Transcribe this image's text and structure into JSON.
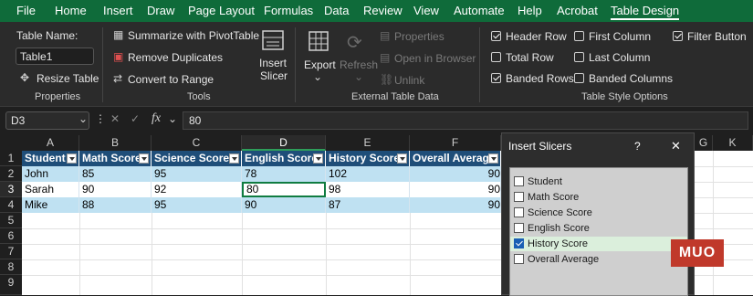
{
  "menu": [
    "File",
    "Home",
    "Insert",
    "Draw",
    "Page Layout",
    "Formulas",
    "Data",
    "Review",
    "View",
    "Automate",
    "Help",
    "Acrobat",
    "Table Design"
  ],
  "ribbon": {
    "properties": {
      "table_name_label": "Table Name:",
      "table_name_value": "Table1",
      "resize": "Resize Table",
      "group": "Properties"
    },
    "tools": {
      "summarize": "Summarize with PivotTable",
      "remove_dup": "Remove Duplicates",
      "convert": "Convert to Range",
      "insert_slicer_1": "Insert",
      "insert_slicer_2": "Slicer",
      "group": "Tools"
    },
    "external": {
      "export": "Export",
      "refresh": "Refresh",
      "properties": "Properties",
      "open_browser": "Open in Browser",
      "unlink": "Unlink",
      "group": "External Table Data"
    },
    "style_options": {
      "header_row": "Header Row",
      "total_row": "Total Row",
      "banded_rows": "Banded Rows",
      "first_column": "First Column",
      "last_column": "Last Column",
      "banded_columns": "Banded Columns",
      "filter_button": "Filter Button",
      "group": "Table Style Options",
      "checked": {
        "header_row": true,
        "total_row": false,
        "banded_rows": true,
        "first_column": false,
        "last_column": false,
        "banded_columns": false,
        "filter_button": true
      }
    }
  },
  "formula_bar": {
    "name_box": "D3",
    "fx": "fx",
    "value": "80"
  },
  "columns": [
    "A",
    "B",
    "C",
    "D",
    "E",
    "F",
    "G",
    "K"
  ],
  "rows": [
    "1",
    "2",
    "3",
    "4",
    "5",
    "6",
    "7",
    "8",
    "9"
  ],
  "table": {
    "headers": [
      "Student",
      "Math Score",
      "Science Score",
      "English Score",
      "History Score",
      "Overall Average"
    ],
    "data": [
      [
        "John",
        "85",
        "95",
        "78",
        "102",
        "90"
      ],
      [
        "Sarah",
        "90",
        "92",
        "80",
        "98",
        "90"
      ],
      [
        "Mike",
        "88",
        "95",
        "90",
        "87",
        "90"
      ]
    ]
  },
  "dialog": {
    "title": "Insert Slicers",
    "help": "?",
    "close": "✕",
    "options": [
      {
        "label": "Student",
        "checked": false
      },
      {
        "label": "Math Score",
        "checked": false
      },
      {
        "label": "Science Score",
        "checked": false
      },
      {
        "label": "English Score",
        "checked": false
      },
      {
        "label": "History Score",
        "checked": true
      },
      {
        "label": "Overall Average",
        "checked": false
      }
    ]
  },
  "watermark": "MUO"
}
